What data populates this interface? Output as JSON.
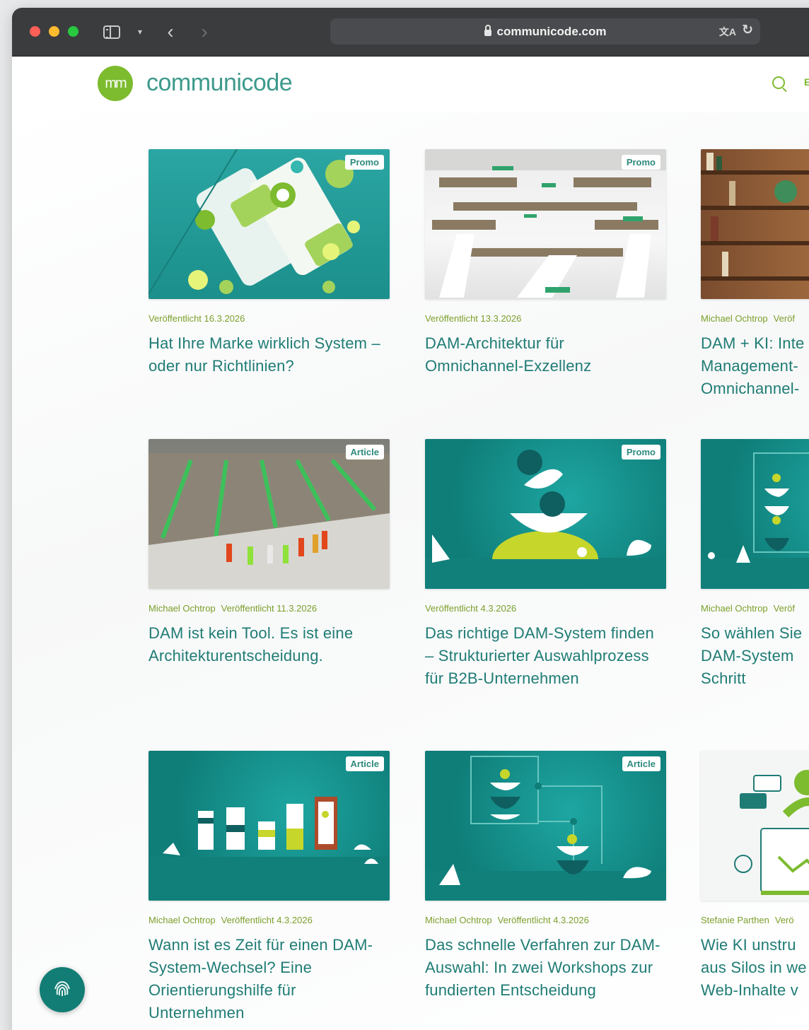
{
  "browser": {
    "url": "communicode.com"
  },
  "site": {
    "logo_mark": "mm",
    "logo_text": "communicode",
    "header_extra": "E"
  },
  "colors": {
    "brand_green": "#7dbb2f",
    "brand_teal": "#1f7c75",
    "meta_green": "#7ba02b"
  },
  "cards": [
    {
      "badge": "Promo",
      "author": "",
      "published": "Veröffentlicht 16.3.2026",
      "title": "Hat Ihre Marke wirklich System – oder nur Richtlinien?"
    },
    {
      "badge": "Promo",
      "author": "",
      "published": "Veröffentlicht 13.3.2026",
      "title": "DAM-Architektur für Omnichannel-Exzellenz"
    },
    {
      "badge": "",
      "author": "Michael Ochtrop",
      "published": "Veröf",
      "title": "DAM + KI: Inte Management- Omnichannel-"
    },
    {
      "badge": "Article",
      "author": "Michael Ochtrop",
      "published": "Veröffentlicht 11.3.2026",
      "title": "DAM ist kein Tool. Es ist eine Architekturentscheidung."
    },
    {
      "badge": "Promo",
      "author": "",
      "published": "Veröffentlicht 4.3.2026",
      "title": "Das richtige DAM-System finden – Strukturierter Auswahlprozess für B2B-Unternehmen"
    },
    {
      "badge": "",
      "author": "Michael Ochtrop",
      "published": "Veröf",
      "title": "So wählen Sie DAM-System Schritt"
    },
    {
      "badge": "Article",
      "author": "Michael Ochtrop",
      "published": "Veröffentlicht 4.3.2026",
      "title": "Wann ist es Zeit für einen DAM-System-Wechsel? Eine Orientierungshilfe für Unternehmen"
    },
    {
      "badge": "Article",
      "author": "Michael Ochtrop",
      "published": "Veröffentlicht 4.3.2026",
      "title": "Das schnelle Verfahren zur DAM-Auswahl: In zwei Workshops zur fundierten Entscheidung"
    },
    {
      "badge": "",
      "author": "Stefanie Parthen",
      "published": "Verö",
      "title": "Wie KI unstru aus Silos in we Web-Inhalte v"
    }
  ]
}
